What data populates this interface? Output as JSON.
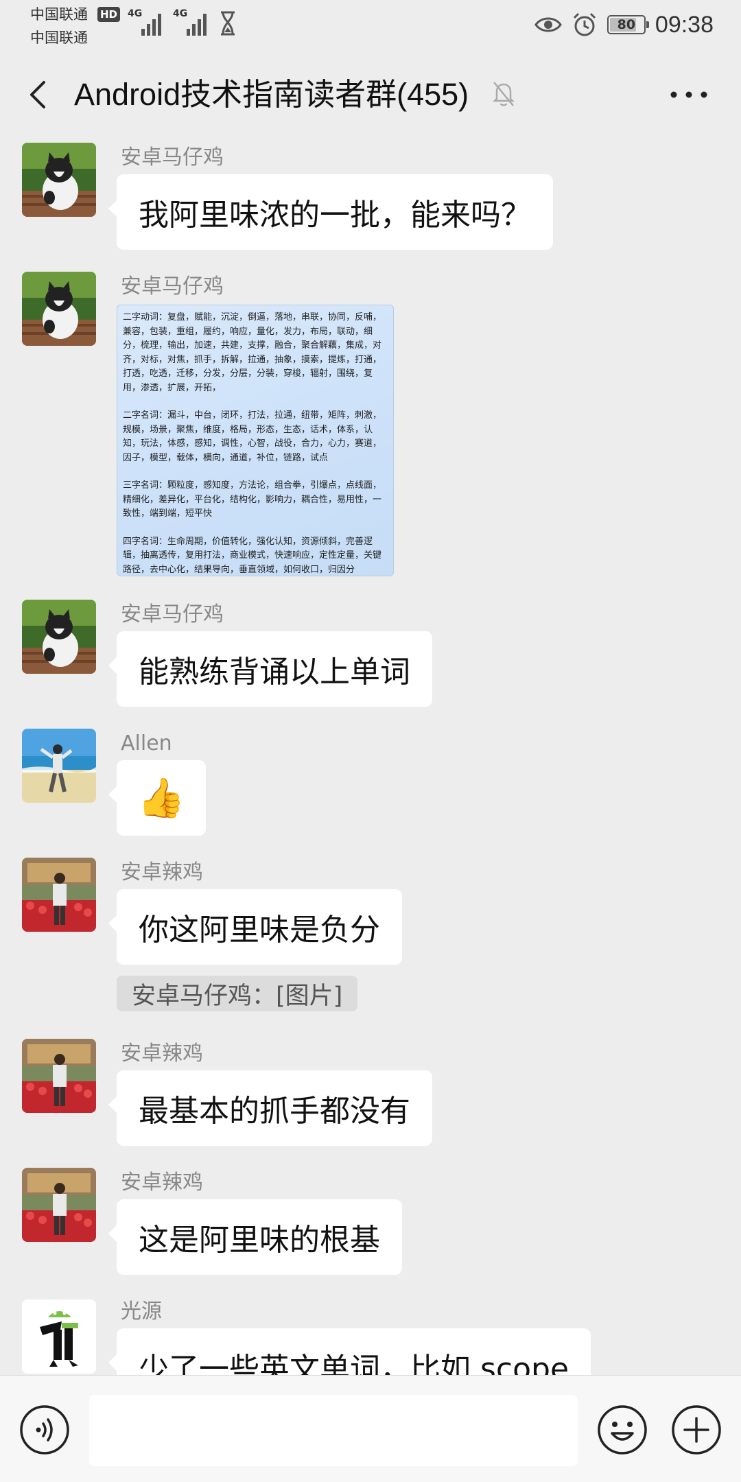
{
  "status_bar": {
    "carrier1": "中国联通",
    "carrier2": "中国联通",
    "hd": "HD",
    "sig1_label": "4G",
    "sig2_label": "4G",
    "battery": "80",
    "battery_level": 0.8,
    "time": "09:38"
  },
  "header": {
    "title": "Android技术指南读者群(455)"
  },
  "messages": [
    {
      "sender": "安卓马仔鸡",
      "text": "我阿里味浓的一批，能来吗？"
    },
    {
      "sender": "安卓马仔鸡",
      "image_text": [
        "二字动词：复盘，赋能，沉淀，倒逼，落地，串联，协同，反哺，兼容，包装，重组，履约，响应，量化，发力，布局，联动，细分，梳理，输出，加速，共建，支撑，融合，聚合解藕，集成，对齐，对标，对焦，抓手，拆解，拉通，抽象，摸索，提炼，打通，打透，吃透，迁移，分发，分层，分装，穿梭，辐射，围绕，复用，渗透，扩展，开拓，",
        "二字名词：漏斗，中台，闭环，打法，拉通，纽带，矩阵，刺激，规模，场景，聚焦，维度，格局，形态，生态，话术，体系，认知，玩法，体感，感知，调性，心智，战役，合力，心力，赛道，因子，模型，载体，横向，通道，补位，链路，试点",
        "三字名词：颗粒度，感知度，方法论，组合拳，引爆点，点线面，精细化，差异化，平台化，结构化，影响力，耦合性，易用性，一致性，端到端，短平快",
        "四字名词：生命周期，价值转化，强化认知，资源倾斜，完善逻辑，抽离透传，复用打法，商业模式，快速响应，定性定量，关键路径，去中心化，结果导向，垂直领域，如何收口，归因分"
      ]
    },
    {
      "sender": "安卓马仔鸡",
      "text": "能熟练背诵以上单词"
    },
    {
      "sender": "Allen",
      "text": "👍"
    },
    {
      "sender": "安卓辣鸡",
      "text": "你这阿里味是负分",
      "quote": "安卓马仔鸡：[图片]"
    },
    {
      "sender": "安卓辣鸡",
      "text": "最基本的抓手都没有"
    },
    {
      "sender": "安卓辣鸡",
      "text": "这是阿里味的根基"
    },
    {
      "sender": "光源",
      "text": "少了一些英文单词，比如 scope"
    }
  ],
  "input_bar": {
    "placeholder": ""
  },
  "colors": {
    "background": "#ededed",
    "bubble": "#ffffff",
    "sender_name": "#888888"
  },
  "icons": [
    "back-arrow-icon",
    "mute-bell-icon",
    "more-dots-icon",
    "voice-icon",
    "emoji-icon",
    "plus-icon",
    "eye-icon",
    "alarm-icon",
    "hourglass-icon"
  ]
}
